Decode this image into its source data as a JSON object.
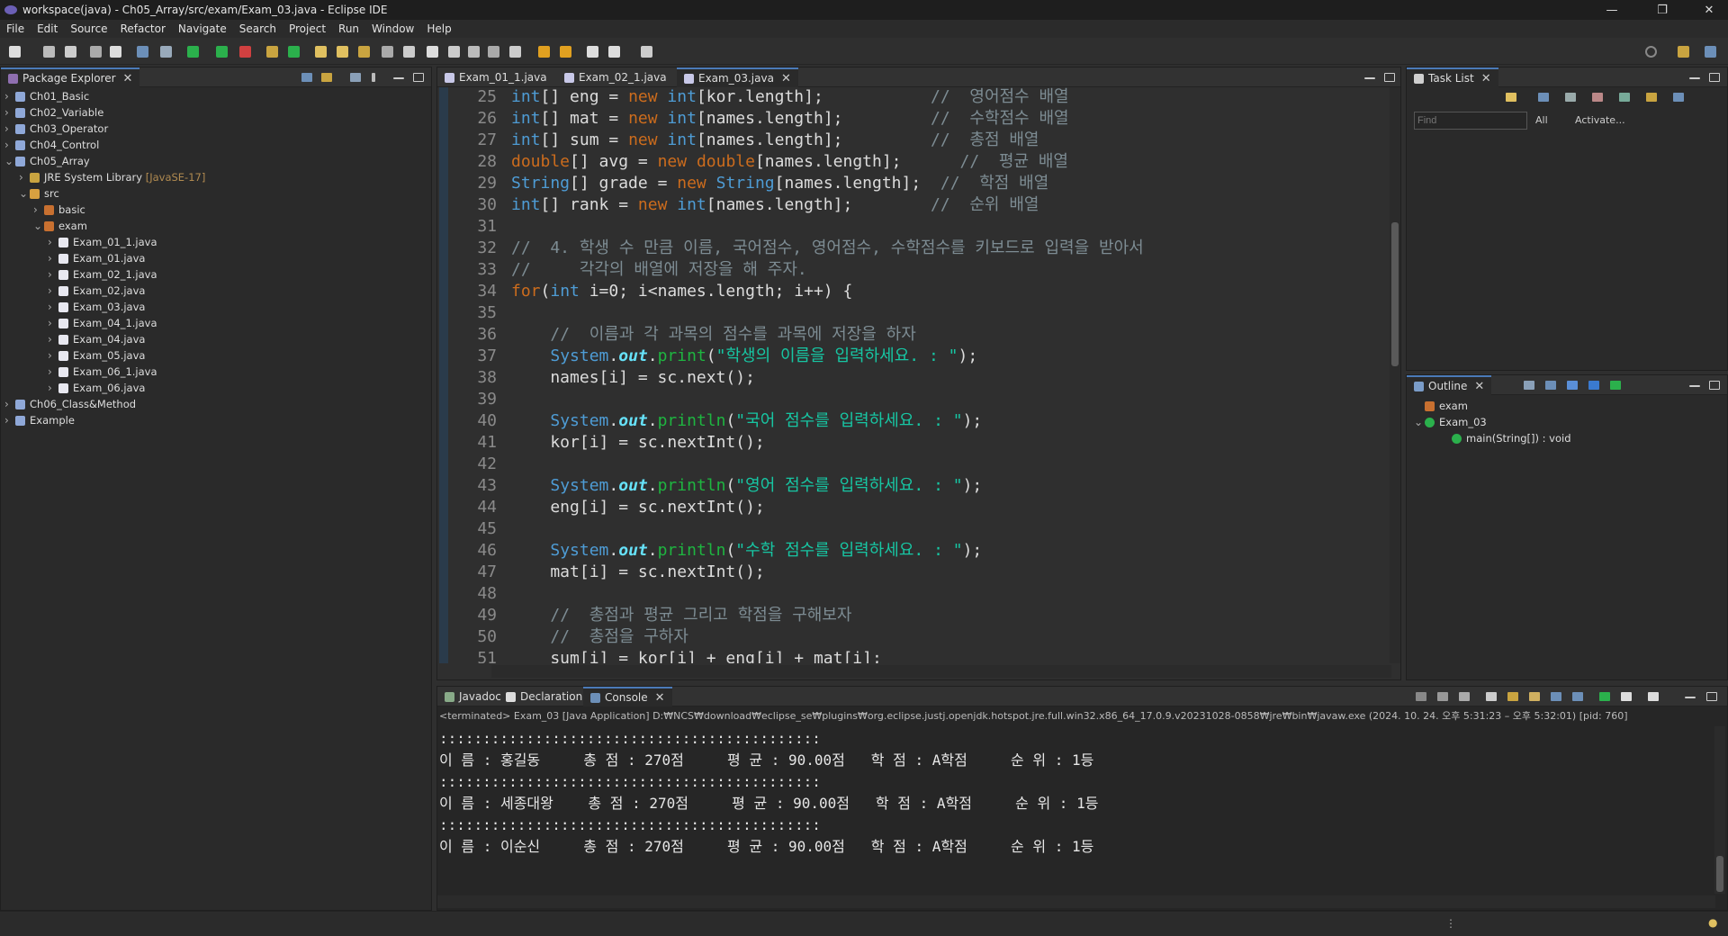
{
  "window": {
    "title": "workspace(java) - Ch05_Array/src/exam/Exam_03.java - Eclipse IDE",
    "minimize": "—",
    "restore": "❐",
    "close": "✕"
  },
  "menu": [
    "File",
    "Edit",
    "Source",
    "Refactor",
    "Navigate",
    "Search",
    "Project",
    "Run",
    "Window",
    "Help"
  ],
  "package_explorer": {
    "title": "Package Explorer",
    "items": [
      {
        "label": "Ch01_Basic",
        "depth": 0,
        "arrow": ">"
      },
      {
        "label": "Ch02_Variable",
        "depth": 0,
        "arrow": ">"
      },
      {
        "label": "Ch03_Operator",
        "depth": 0,
        "arrow": ">"
      },
      {
        "label": "Ch04_Control",
        "depth": 0,
        "arrow": ">"
      },
      {
        "label": "Ch05_Array",
        "depth": 0,
        "arrow": "v"
      },
      {
        "label": "JRE System Library",
        "suffix": "[JavaSE-17]",
        "depth": 1,
        "arrow": ">"
      },
      {
        "label": "src",
        "depth": 1,
        "arrow": "v"
      },
      {
        "label": "basic",
        "depth": 2,
        "arrow": ">"
      },
      {
        "label": "exam",
        "depth": 2,
        "arrow": "v"
      },
      {
        "label": "Exam_01_1.java",
        "depth": 3,
        "arrow": ">"
      },
      {
        "label": "Exam_01.java",
        "depth": 3,
        "arrow": ">"
      },
      {
        "label": "Exam_02_1.java",
        "depth": 3,
        "arrow": ">"
      },
      {
        "label": "Exam_02.java",
        "depth": 3,
        "arrow": ">"
      },
      {
        "label": "Exam_03.java",
        "depth": 3,
        "arrow": ">"
      },
      {
        "label": "Exam_04_1.java",
        "depth": 3,
        "arrow": ">"
      },
      {
        "label": "Exam_04.java",
        "depth": 3,
        "arrow": ">"
      },
      {
        "label": "Exam_05.java",
        "depth": 3,
        "arrow": ">"
      },
      {
        "label": "Exam_06_1.java",
        "depth": 3,
        "arrow": ">"
      },
      {
        "label": "Exam_06.java",
        "depth": 3,
        "arrow": ">"
      },
      {
        "label": "Ch06_Class&Method",
        "depth": 0,
        "arrow": ">"
      },
      {
        "label": "Example",
        "depth": 0,
        "arrow": ">"
      }
    ]
  },
  "editor_tabs": [
    "Exam_01_1.java",
    "Exam_02_1.java",
    "Exam_03.java"
  ],
  "code_lines": [
    {
      "n": "25",
      "t": [
        [
          "ty",
          "int"
        ],
        [
          "id",
          "[] eng = "
        ],
        [
          "kw",
          "new "
        ],
        [
          "ty",
          "int"
        ],
        [
          "id",
          "[kor.length];"
        ],
        [
          "cm",
          "           //  영어점수 배열"
        ]
      ]
    },
    {
      "n": "26",
      "t": [
        [
          "ty",
          "int"
        ],
        [
          "id",
          "[] mat = "
        ],
        [
          "kw",
          "new "
        ],
        [
          "ty",
          "int"
        ],
        [
          "id",
          "[names.length];"
        ],
        [
          "cm",
          "         //  수학점수 배열"
        ]
      ]
    },
    {
      "n": "27",
      "t": [
        [
          "ty",
          "int"
        ],
        [
          "id",
          "[] sum = "
        ],
        [
          "kw",
          "new "
        ],
        [
          "ty",
          "int"
        ],
        [
          "id",
          "[names.length];"
        ],
        [
          "cm",
          "         //  총점 배열"
        ]
      ]
    },
    {
      "n": "28",
      "t": [
        [
          "kw",
          "double"
        ],
        [
          "id",
          "[] avg = "
        ],
        [
          "kw",
          "new "
        ],
        [
          "kw",
          "double"
        ],
        [
          "id",
          "[names.length];"
        ],
        [
          "cm",
          "      //  평균 배열"
        ]
      ]
    },
    {
      "n": "29",
      "t": [
        [
          "ty",
          "String"
        ],
        [
          "id",
          "[] grade = "
        ],
        [
          "kw",
          "new "
        ],
        [
          "ty",
          "String"
        ],
        [
          "id",
          "[names.length];"
        ],
        [
          "cm",
          "  //  학점 배열"
        ]
      ]
    },
    {
      "n": "30",
      "t": [
        [
          "ty",
          "int"
        ],
        [
          "id",
          "[] rank = "
        ],
        [
          "kw",
          "new "
        ],
        [
          "ty",
          "int"
        ],
        [
          "id",
          "[names.length];"
        ],
        [
          "cm",
          "        //  순위 배열"
        ]
      ]
    },
    {
      "n": "31",
      "t": []
    },
    {
      "n": "32",
      "t": [
        [
          "cm",
          "//  4. 학생 수 만큼 이름, 국어점수, 영어점수, 수학점수를 키보드로 입력을 받아서"
        ]
      ]
    },
    {
      "n": "33",
      "t": [
        [
          "cm",
          "//     각각의 배열에 저장을 해 주자."
        ]
      ]
    },
    {
      "n": "34",
      "t": [
        [
          "kw",
          "for"
        ],
        [
          "id",
          "("
        ],
        [
          "ty",
          "int "
        ],
        [
          "id",
          "i=0; i<names.length; i++) {"
        ]
      ]
    },
    {
      "n": "35",
      "t": []
    },
    {
      "n": "36",
      "t": [
        [
          "id",
          "    "
        ],
        [
          "cm",
          "//  이름과 각 과목의 점수를 과목에 저장을 하자"
        ]
      ]
    },
    {
      "n": "37",
      "t": [
        [
          "id",
          "    "
        ],
        [
          "ty",
          "System"
        ],
        [
          "id",
          "."
        ],
        [
          "fld",
          "out"
        ],
        [
          "id",
          "."
        ],
        [
          "fn",
          "print"
        ],
        [
          "id",
          "("
        ],
        [
          "st",
          "\"학생의 이름을 입력하세요. : \""
        ],
        [
          "id",
          ");"
        ]
      ]
    },
    {
      "n": "38",
      "t": [
        [
          "id",
          "    names[i] = sc.next();"
        ]
      ]
    },
    {
      "n": "39",
      "t": []
    },
    {
      "n": "40",
      "t": [
        [
          "id",
          "    "
        ],
        [
          "ty",
          "System"
        ],
        [
          "id",
          "."
        ],
        [
          "fld",
          "out"
        ],
        [
          "id",
          "."
        ],
        [
          "fn",
          "println"
        ],
        [
          "id",
          "("
        ],
        [
          "st",
          "\"국어 점수를 입력하세요. : \""
        ],
        [
          "id",
          ");"
        ]
      ]
    },
    {
      "n": "41",
      "t": [
        [
          "id",
          "    kor[i] = sc.nextInt();"
        ]
      ]
    },
    {
      "n": "42",
      "t": []
    },
    {
      "n": "43",
      "t": [
        [
          "id",
          "    "
        ],
        [
          "ty",
          "System"
        ],
        [
          "id",
          "."
        ],
        [
          "fld",
          "out"
        ],
        [
          "id",
          "."
        ],
        [
          "fn",
          "println"
        ],
        [
          "id",
          "("
        ],
        [
          "st",
          "\"영어 점수를 입력하세요. : \""
        ],
        [
          "id",
          ");"
        ]
      ]
    },
    {
      "n": "44",
      "t": [
        [
          "id",
          "    eng[i] = sc.nextInt();"
        ]
      ]
    },
    {
      "n": "45",
      "t": []
    },
    {
      "n": "46",
      "t": [
        [
          "id",
          "    "
        ],
        [
          "ty",
          "System"
        ],
        [
          "id",
          "."
        ],
        [
          "fld",
          "out"
        ],
        [
          "id",
          "."
        ],
        [
          "fn",
          "println"
        ],
        [
          "id",
          "("
        ],
        [
          "st",
          "\"수학 점수를 입력하세요. : \""
        ],
        [
          "id",
          ");"
        ]
      ]
    },
    {
      "n": "47",
      "t": [
        [
          "id",
          "    mat[i] = sc.nextInt();"
        ]
      ]
    },
    {
      "n": "48",
      "t": []
    },
    {
      "n": "49",
      "t": [
        [
          "id",
          "    "
        ],
        [
          "cm",
          "//  총점과 평균 그리고 학점을 구해보자"
        ]
      ]
    },
    {
      "n": "50",
      "t": [
        [
          "id",
          "    "
        ],
        [
          "cm",
          "//  총점을 구하자"
        ]
      ]
    },
    {
      "n": "51",
      "t": [
        [
          "id",
          "    sum[i] = kor[i] + eng[i] + mat[i];"
        ]
      ]
    }
  ],
  "task_list": {
    "title": "Task List",
    "find_placeholder": "Find",
    "all": "All",
    "activate": "Activate..."
  },
  "outline": {
    "title": "Outline",
    "items": [
      {
        "label": "exam",
        "depth": 0
      },
      {
        "label": "Exam_03",
        "depth": 0
      },
      {
        "label": "main(String[]) : void",
        "depth": 1
      }
    ]
  },
  "bottom_tabs": [
    "Javadoc",
    "Declaration",
    "Console"
  ],
  "console": {
    "terminated": "<terminated> Exam_03 [Java Application] D:₩NCS₩download₩eclipse_se₩plugins₩org.eclipse.justj.openjdk.hotspot.jre.full.win32.x86_64_17.0.9.v20231028-0858₩jre₩bin₩javaw.exe  (2024. 10. 24. 오후 5:31:23 – 오후 5:32:01) [pid: 760]",
    "lines": [
      "::::::::::::::::::::::::::::::::::::::::::::",
      "이 름 : 홍길동     총 점 : 270점     평 균 : 90.00점   학 점 : A학점     순 위 : 1등",
      "::::::::::::::::::::::::::::::::::::::::::::",
      "이 름 : 세종대왕    총 점 : 270점     평 균 : 90.00점   학 점 : A학점     순 위 : 1등",
      "::::::::::::::::::::::::::::::::::::::::::::",
      "이 름 : 이순신     총 점 : 270점     평 균 : 90.00점   학 점 : A학점     순 위 : 1등"
    ]
  },
  "colors": {
    "accent": "#4b7ab8",
    "keyword": "#cc6c1d",
    "type": "#4e9cd5",
    "method": "#1eb540",
    "string": "#17c6a3",
    "comment": "#7d8c93"
  }
}
